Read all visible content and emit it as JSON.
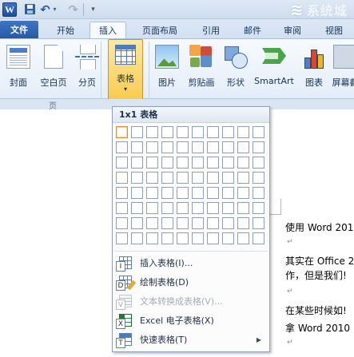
{
  "quick_access": {
    "app_icon": "word-app-icon",
    "save_icon": "save-icon",
    "undo_icon": "undo-icon",
    "redo_icon": "redo-icon",
    "logo_letter": "W",
    "undo_glyph": "↶",
    "redo_glyph": "↷",
    "dropdown_glyph": "▾"
  },
  "watermark": {
    "text": "系统城",
    "mark": "≋"
  },
  "tabs": [
    {
      "label": "文件",
      "active": false
    },
    {
      "label": "开始",
      "active": false
    },
    {
      "label": "插入",
      "active": true
    },
    {
      "label": "页面布局",
      "active": false
    },
    {
      "label": "引用",
      "active": false
    },
    {
      "label": "邮件",
      "active": false
    },
    {
      "label": "审阅",
      "active": false
    },
    {
      "label": "视图",
      "active": false
    }
  ],
  "ribbon": {
    "buttons": [
      {
        "label": "封面",
        "icon": "cover-page-icon"
      },
      {
        "label": "空白页",
        "icon": "blank-page-icon"
      },
      {
        "label": "分页",
        "icon": "page-break-icon"
      },
      {
        "label": "表格",
        "icon": "table-icon",
        "pressed": true
      },
      {
        "label": "图片",
        "icon": "picture-icon"
      },
      {
        "label": "剪贴画",
        "icon": "clip-art-icon"
      },
      {
        "label": "形状",
        "icon": "shapes-icon"
      },
      {
        "label": "SmartArt",
        "icon": "smartart-icon"
      },
      {
        "label": "图表",
        "icon": "chart-icon"
      },
      {
        "label": "屏幕截",
        "icon": "screenshot-icon"
      }
    ],
    "group_label": "页"
  },
  "table_menu": {
    "header": "1x1 表格",
    "grid_cols": 10,
    "grid_rows": 8,
    "selected": {
      "cols": 1,
      "rows": 1
    },
    "items": [
      {
        "label": "插入表格(I)...",
        "key": "I",
        "icon": "insert-table-icon",
        "disabled": false,
        "submenu": false
      },
      {
        "label": "绘制表格(D)",
        "key": "D",
        "icon": "draw-table-icon",
        "disabled": false,
        "submenu": false
      },
      {
        "label": "文本转换成表格(V)...",
        "key": "V",
        "icon": "convert-text-to-table-icon",
        "disabled": true,
        "submenu": false
      },
      {
        "label": "Excel 电子表格(X)",
        "key": "X",
        "icon": "excel-spreadsheet-icon",
        "disabled": false,
        "submenu": false
      },
      {
        "label": "快速表格(T)",
        "key": "T",
        "icon": "quick-tables-icon",
        "disabled": false,
        "submenu": true
      }
    ]
  },
  "document": {
    "lines": [
      "使用 Word 201",
      "其实在 Office 2",
      "作，但是我们!",
      "在某些时候如!",
      "拿 Word 2010 ;"
    ],
    "para_mark": "↵"
  },
  "colors": {
    "accent": "#2559a8",
    "table_button_bg": "#f9c94d",
    "selected_cell": "#e38c2b"
  }
}
